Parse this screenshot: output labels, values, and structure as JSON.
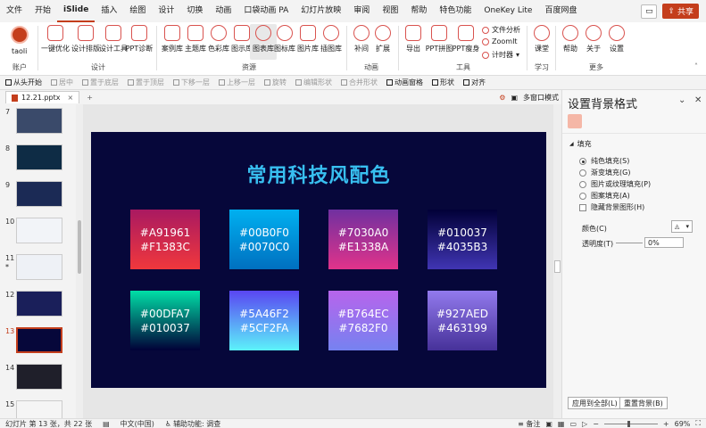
{
  "menu": [
    "文件",
    "开始",
    "iSlide",
    "插入",
    "绘图",
    "设计",
    "切换",
    "动画",
    "口袋动画 PA",
    "幻灯片放映",
    "审阅",
    "视图",
    "帮助",
    "特色功能",
    "OneKey Lite",
    "百度网盘"
  ],
  "menu_active_index": 2,
  "share_label": "共享",
  "ribbon": {
    "account_name": "taoli",
    "groups": {
      "account": "账户",
      "design": "设计",
      "resources": "资源",
      "animation": "动画",
      "tools": "工具",
      "learn": "学习",
      "more": "更多"
    },
    "buttons": {
      "onekey_optimize": "一键优化",
      "design_layout": "设计排版",
      "design_tools": "设计工具",
      "ppt_diagnose": "PPT诊断",
      "case_lib": "案例库",
      "theme_lib": "主题库",
      "color_lib": "色彩库",
      "diagram_lib": "图示库",
      "chart_lib": "图表库",
      "icon_lib": "图标库",
      "image_lib": "图片库",
      "illustration_lib": "插图库",
      "tween": "补间",
      "extend": "扩展",
      "export": "导出",
      "ppt_splice": "PPT拼图",
      "ppt_slim": "PPT瘦身",
      "file_analysis": "文件分析",
      "zoomit": "ZoomIt",
      "timer": "计时器",
      "classroom": "课堂",
      "help": "帮助",
      "about": "关于",
      "settings": "设置"
    }
  },
  "toolbar2": [
    "从头开始",
    "居中",
    "置于底层",
    "置于顶层",
    "下移一层",
    "上移一层",
    "旋转",
    "编辑形状",
    "合并形状",
    "动画窗格",
    "形状",
    "对齐"
  ],
  "file_tab": "12.21.pptx",
  "multi_window": "多窗口模式",
  "thumbnails": [
    {
      "num": "7",
      "selected": false,
      "star": false,
      "color": "#3a4a6a"
    },
    {
      "num": "8",
      "selected": false,
      "star": false,
      "color": "#0e2c45"
    },
    {
      "num": "9",
      "selected": false,
      "star": false,
      "color": "#1b2a55"
    },
    {
      "num": "10",
      "selected": false,
      "star": false,
      "color": "#f2f4f8"
    },
    {
      "num": "11",
      "selected": false,
      "star": true,
      "color": "#eef1f6"
    },
    {
      "num": "12",
      "selected": false,
      "star": false,
      "color": "#1a1f5a"
    },
    {
      "num": "13",
      "selected": true,
      "star": false,
      "color": "#06073a"
    },
    {
      "num": "14",
      "selected": false,
      "star": false,
      "color": "#1f1f2a"
    },
    {
      "num": "15",
      "selected": false,
      "star": false,
      "color": "#f5f5f5"
    }
  ],
  "slide": {
    "title": "常用科技风配色",
    "swatches": [
      {
        "c1": "#A91961",
        "c2": "#F1383C",
        "line1": "#A91961",
        "line2": "#F1383C"
      },
      {
        "c1": "#00B0F0",
        "c2": "#0070C0",
        "line1": "#00B0F0",
        "line2": "#0070C0"
      },
      {
        "c1": "#7030A0",
        "c2": "#E1338A",
        "line1": "#7030A0",
        "line2": "#E1338A"
      },
      {
        "c1": "#010037",
        "c2": "#4035B3",
        "line1": "#010037",
        "line2": "#4035B3"
      },
      {
        "c1": "#00DFA7",
        "c2": "#010037",
        "line1": "#00DFA7",
        "line2": "#010037"
      },
      {
        "c1": "#5A46F2",
        "c2": "#5CF2FA",
        "line1": "#5A46F2",
        "line2": "#5CF2FA"
      },
      {
        "c1": "#B764EC",
        "c2": "#7682F0",
        "line1": "#B764EC",
        "line2": "#7682F0"
      },
      {
        "c1": "#927AED",
        "c2": "#463199",
        "line1": "#927AED",
        "line2": "#463199"
      }
    ]
  },
  "panel": {
    "title": "设置背景格式",
    "section": "填充",
    "options": [
      "纯色填充(S)",
      "渐变填充(G)",
      "图片或纹理填充(P)",
      "图案填充(A)"
    ],
    "selected_option": 0,
    "hide_bg": "隐藏背景图形(H)",
    "color_label": "颜色(C)",
    "transparency_label": "透明度(T)",
    "transparency_value": "0%",
    "apply_all": "应用到全部(L)",
    "reset_bg": "重置背景(B)"
  },
  "status": {
    "slide_info": "幻灯片 第 13 张，共 22 张",
    "language": "中文(中国)",
    "accessibility": "辅助功能: 调查",
    "notes": "备注",
    "zoom": "69%"
  }
}
